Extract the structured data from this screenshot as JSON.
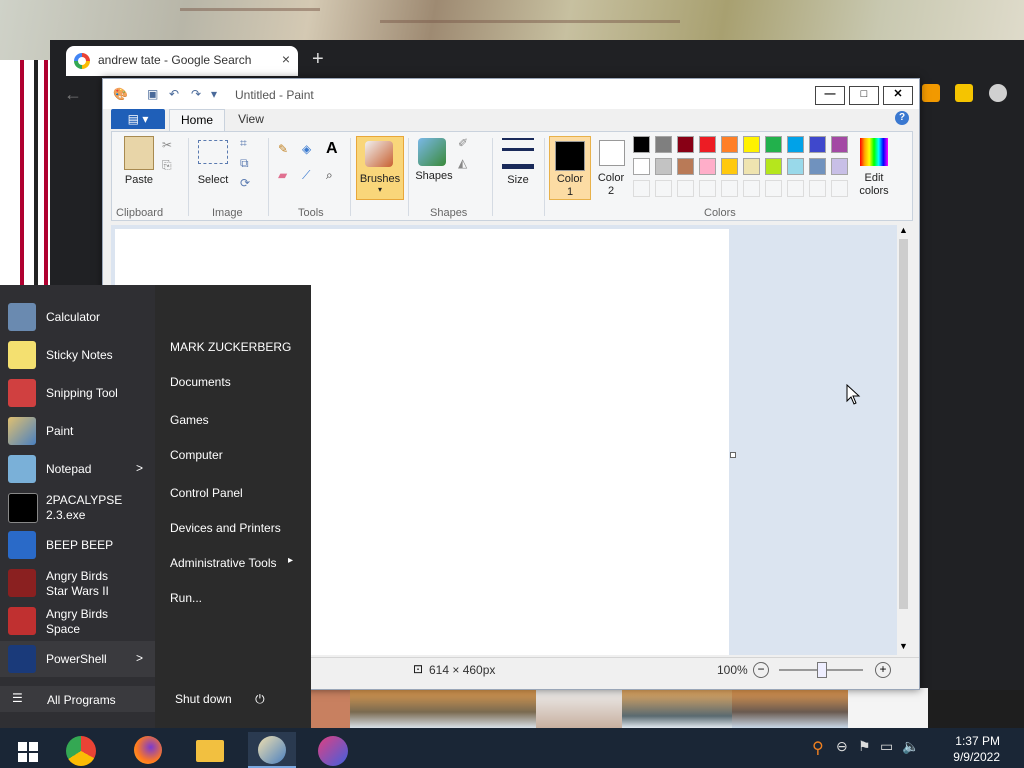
{
  "browser": {
    "tab_title": "andrew tate - Google Search",
    "tab_close": "×",
    "new_tab": "+",
    "back": "←"
  },
  "paint": {
    "title": "Untitled - Paint",
    "file_menu": "▤ ▾",
    "tabs": {
      "home": "Home",
      "view": "View"
    },
    "help": "?",
    "groups": {
      "clipboard": "Clipboard",
      "image": "Image",
      "tools": "Tools",
      "shapes": "Shapes",
      "colors": "Colors"
    },
    "buttons": {
      "paste": "Paste",
      "select": "Select",
      "brushes": "Brushes",
      "shapes": "Shapes",
      "size": "Size",
      "color1_line1": "Color",
      "color1_line2": "1",
      "color2_line1": "Color",
      "color2_line2": "2",
      "edit_colors_line1": "Edit",
      "edit_colors_line2": "colors"
    },
    "palette_row1": [
      "#000000",
      "#7f7f7f",
      "#880015",
      "#ed1c24",
      "#ff7f27",
      "#fff200",
      "#22b14c",
      "#00a2e8",
      "#3f48cc",
      "#a349a4"
    ],
    "palette_row2": [
      "#ffffff",
      "#c3c3c3",
      "#b97a57",
      "#ffaec9",
      "#ffc90e",
      "#efe4b0",
      "#b5e61d",
      "#99d9ea",
      "#7092be",
      "#c8bfe7"
    ],
    "status": {
      "resolution": "614 × 460px",
      "zoom": "100%",
      "zoom_out": "−",
      "zoom_in": "+"
    }
  },
  "start_menu": {
    "pinned": [
      {
        "label": "Calculator"
      },
      {
        "label": "Sticky Notes"
      },
      {
        "label": "Snipping Tool"
      },
      {
        "label": "Paint"
      },
      {
        "label": "Notepad"
      },
      {
        "label_line1": "2PACALYPSE",
        "label_line2": "2.3.exe"
      },
      {
        "label": "BEEP BEEP"
      },
      {
        "label_line1": "Angry Birds",
        "label_line2": "Star Wars II"
      },
      {
        "label_line1": "Angry Birds",
        "label_line2": "Space"
      },
      {
        "label": "PowerShell"
      }
    ],
    "all_programs": "All Programs",
    "right_items": [
      "MARK ZUCKERBERG",
      "Documents",
      "Games",
      "Computer",
      "Control Panel",
      "Devices and Printers",
      "Administrative Tools",
      "Run..."
    ],
    "shutdown": "Shut down"
  },
  "taskbar": {
    "apps": [
      "start-icon",
      "chrome-icon",
      "firefox-icon",
      "file-explorer-icon",
      "paint-icon",
      "picsart-icon"
    ],
    "time": "1:37 PM",
    "date": "9/9/2022"
  }
}
